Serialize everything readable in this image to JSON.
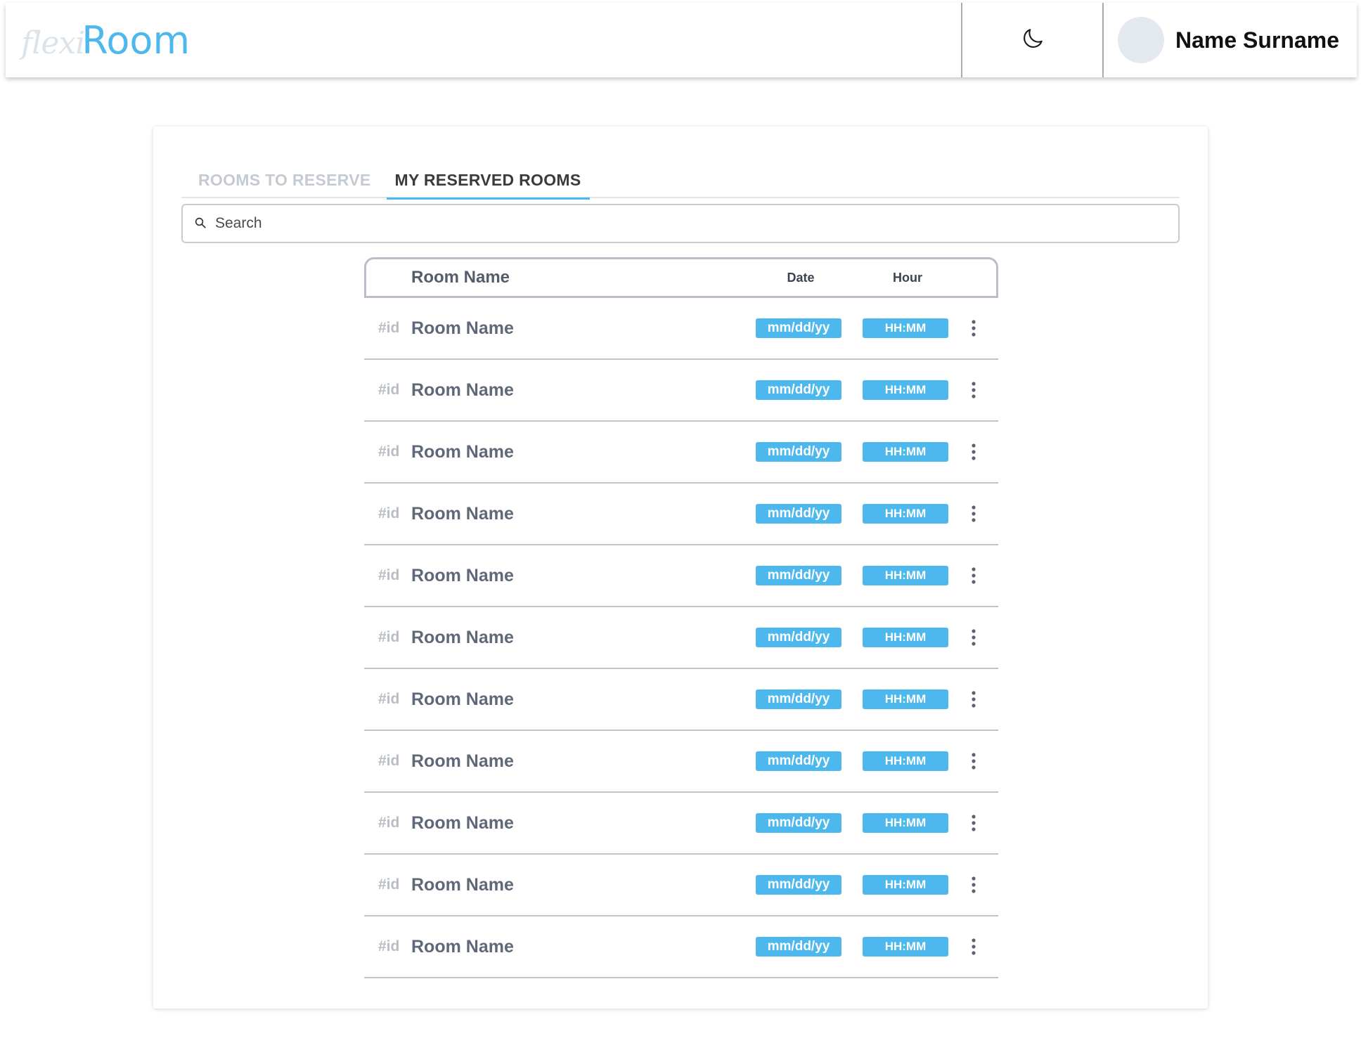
{
  "header": {
    "brand_prefix": "flexi",
    "brand_main": "Room",
    "theme_icon": "moon-icon",
    "user_name": "Name Surname"
  },
  "tabs": [
    {
      "label": "ROOMS TO RESERVE",
      "active": false
    },
    {
      "label": "MY RESERVED ROOMS",
      "active": true
    }
  ],
  "search": {
    "placeholder": "Search",
    "value": ""
  },
  "table": {
    "columns": {
      "room": "Room Name",
      "date": "Date",
      "hour": "Hour"
    },
    "rows": [
      {
        "id": "#id",
        "name": "Room Name",
        "date": "mm/dd/yy",
        "hour": "HH:MM"
      },
      {
        "id": "#id",
        "name": "Room Name",
        "date": "mm/dd/yy",
        "hour": "HH:MM"
      },
      {
        "id": "#id",
        "name": "Room Name",
        "date": "mm/dd/yy",
        "hour": "HH:MM"
      },
      {
        "id": "#id",
        "name": "Room Name",
        "date": "mm/dd/yy",
        "hour": "HH:MM"
      },
      {
        "id": "#id",
        "name": "Room Name",
        "date": "mm/dd/yy",
        "hour": "HH:MM"
      },
      {
        "id": "#id",
        "name": "Room Name",
        "date": "mm/dd/yy",
        "hour": "HH:MM"
      },
      {
        "id": "#id",
        "name": "Room Name",
        "date": "mm/dd/yy",
        "hour": "HH:MM"
      },
      {
        "id": "#id",
        "name": "Room Name",
        "date": "mm/dd/yy",
        "hour": "HH:MM"
      },
      {
        "id": "#id",
        "name": "Room Name",
        "date": "mm/dd/yy",
        "hour": "HH:MM"
      },
      {
        "id": "#id",
        "name": "Room Name",
        "date": "mm/dd/yy",
        "hour": "HH:MM"
      },
      {
        "id": "#id",
        "name": "Room Name",
        "date": "mm/dd/yy",
        "hour": "HH:MM"
      }
    ]
  },
  "colors": {
    "accent": "#4cb8ee",
    "muted_text": "#c5cbd3",
    "row_name": "#5f6878"
  }
}
